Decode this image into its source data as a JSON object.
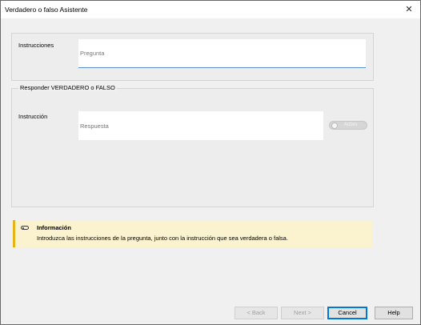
{
  "window": {
    "title": "Verdadero o falso Asistente",
    "close_glyph": "✕"
  },
  "instructions": {
    "label": "Instrucciones",
    "placeholder": "Pregunta",
    "value": ""
  },
  "answer_group": {
    "caption": "Responder VERDADERO o FALSO",
    "label": "Instrucción",
    "placeholder": "Respuesta",
    "value": "",
    "toggle_label": "Activo"
  },
  "info": {
    "icon": "toggle-icon",
    "heading": "Información",
    "text": "Introduzca las instrucciones de la pregunta, junto con la instrucción que sea verdadera o falsa."
  },
  "buttons": {
    "back": "< Back",
    "next": "Next >",
    "cancel": "Cancel",
    "help": "Help"
  },
  "colors": {
    "info_accent": "#e7b417",
    "info_background": "#fbf2cf",
    "focus_blue": "#0078d7"
  }
}
